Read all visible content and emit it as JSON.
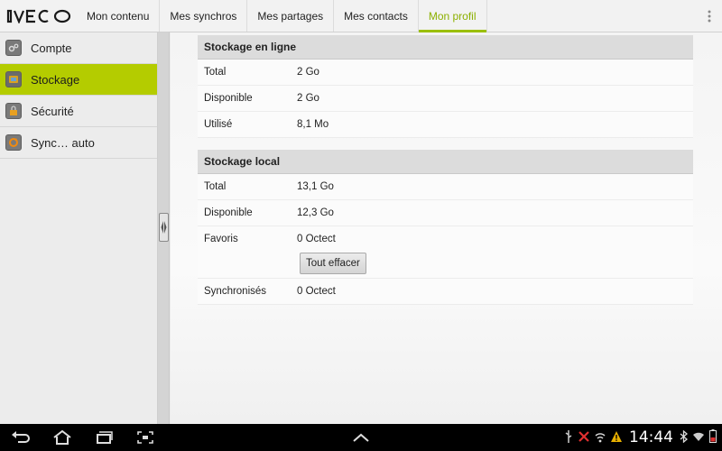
{
  "app": {
    "logo_text": "IVECO"
  },
  "tabs": [
    {
      "label": "Mon contenu",
      "active": false
    },
    {
      "label": "Mes synchros",
      "active": false
    },
    {
      "label": "Mes partages",
      "active": false
    },
    {
      "label": "Mes contacts",
      "active": false
    },
    {
      "label": "Mon profil",
      "active": true
    }
  ],
  "sidebar": {
    "items": [
      {
        "label": "Compte",
        "icon": "gears-icon",
        "selected": false
      },
      {
        "label": "Stockage",
        "icon": "storage-icon",
        "selected": true
      },
      {
        "label": "Sécurité",
        "icon": "lock-icon",
        "selected": false
      },
      {
        "label": "Sync… auto",
        "icon": "sync-icon",
        "selected": false
      }
    ]
  },
  "online_storage": {
    "title": "Stockage en ligne",
    "rows": [
      {
        "label": "Total",
        "value": "2 Go"
      },
      {
        "label": "Disponible",
        "value": "2 Go"
      },
      {
        "label": "Utilisé",
        "value": "8,1 Mo"
      }
    ]
  },
  "local_storage": {
    "title": "Stockage local",
    "rows": [
      {
        "label": "Total",
        "value": "13,1 Go"
      },
      {
        "label": "Disponible",
        "value": "12,3 Go"
      },
      {
        "label": "Favoris",
        "value": "0 Octect"
      },
      {
        "label": "Synchronisés",
        "value": "0 Octect"
      }
    ],
    "clear_button": "Tout effacer"
  },
  "system_bar": {
    "time": "14:44"
  },
  "colors": {
    "accent": "#b4cc00",
    "active_tab_text": "#8cb000"
  }
}
